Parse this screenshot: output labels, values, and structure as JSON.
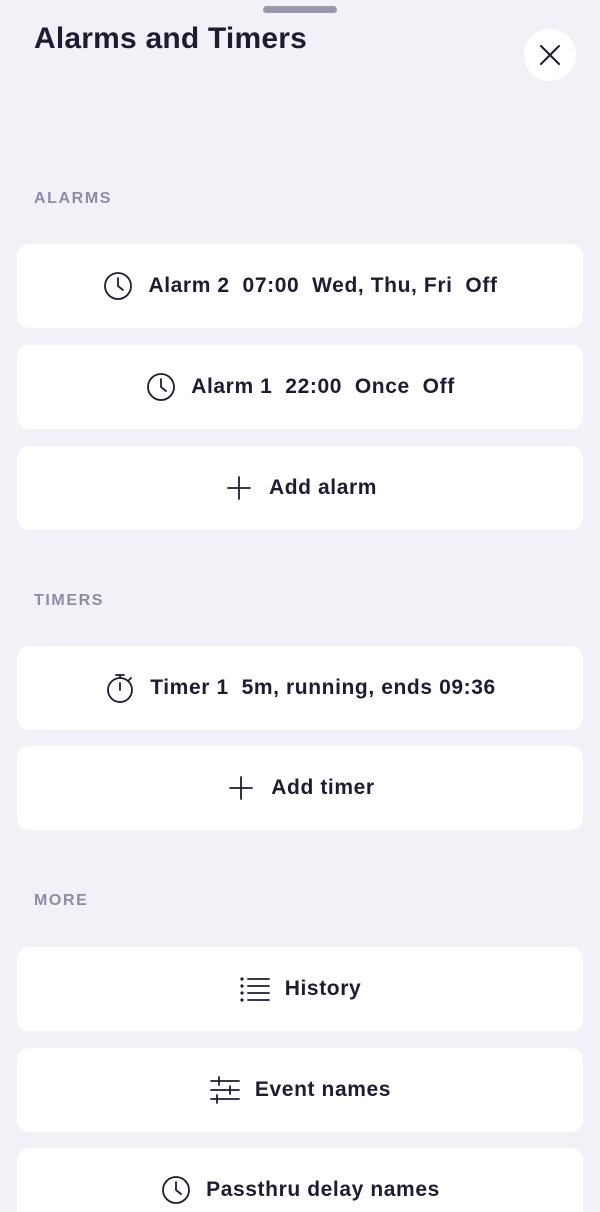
{
  "header": {
    "title": "Alarms and Timers",
    "close_icon": "close-icon"
  },
  "sections": {
    "alarms": {
      "label": "ALARMS",
      "items": [
        {
          "icon": "clock-icon",
          "label": "Alarm 2  07:00  Wed, Thu, Fri  Off"
        },
        {
          "icon": "clock-icon",
          "label": "Alarm 1  22:00  Once  Off"
        }
      ],
      "add_label": "Add alarm",
      "add_icon": "plus-icon"
    },
    "timers": {
      "label": "TIMERS",
      "items": [
        {
          "icon": "stopwatch-icon",
          "label": "Timer 1  5m, running, ends 09:36"
        }
      ],
      "add_label": "Add timer",
      "add_icon": "plus-icon"
    },
    "more": {
      "label": "MORE",
      "items": [
        {
          "icon": "list-icon",
          "label": "History"
        },
        {
          "icon": "sliders-icon",
          "label": "Event names"
        },
        {
          "icon": "clock-icon",
          "label": "Passthru delay names"
        }
      ]
    }
  },
  "colors": {
    "background": "#f2f1f8",
    "card": "#ffffff",
    "text": "#1d1c33",
    "section_label": "#8e8ca4",
    "handle": "#9a98ad"
  }
}
